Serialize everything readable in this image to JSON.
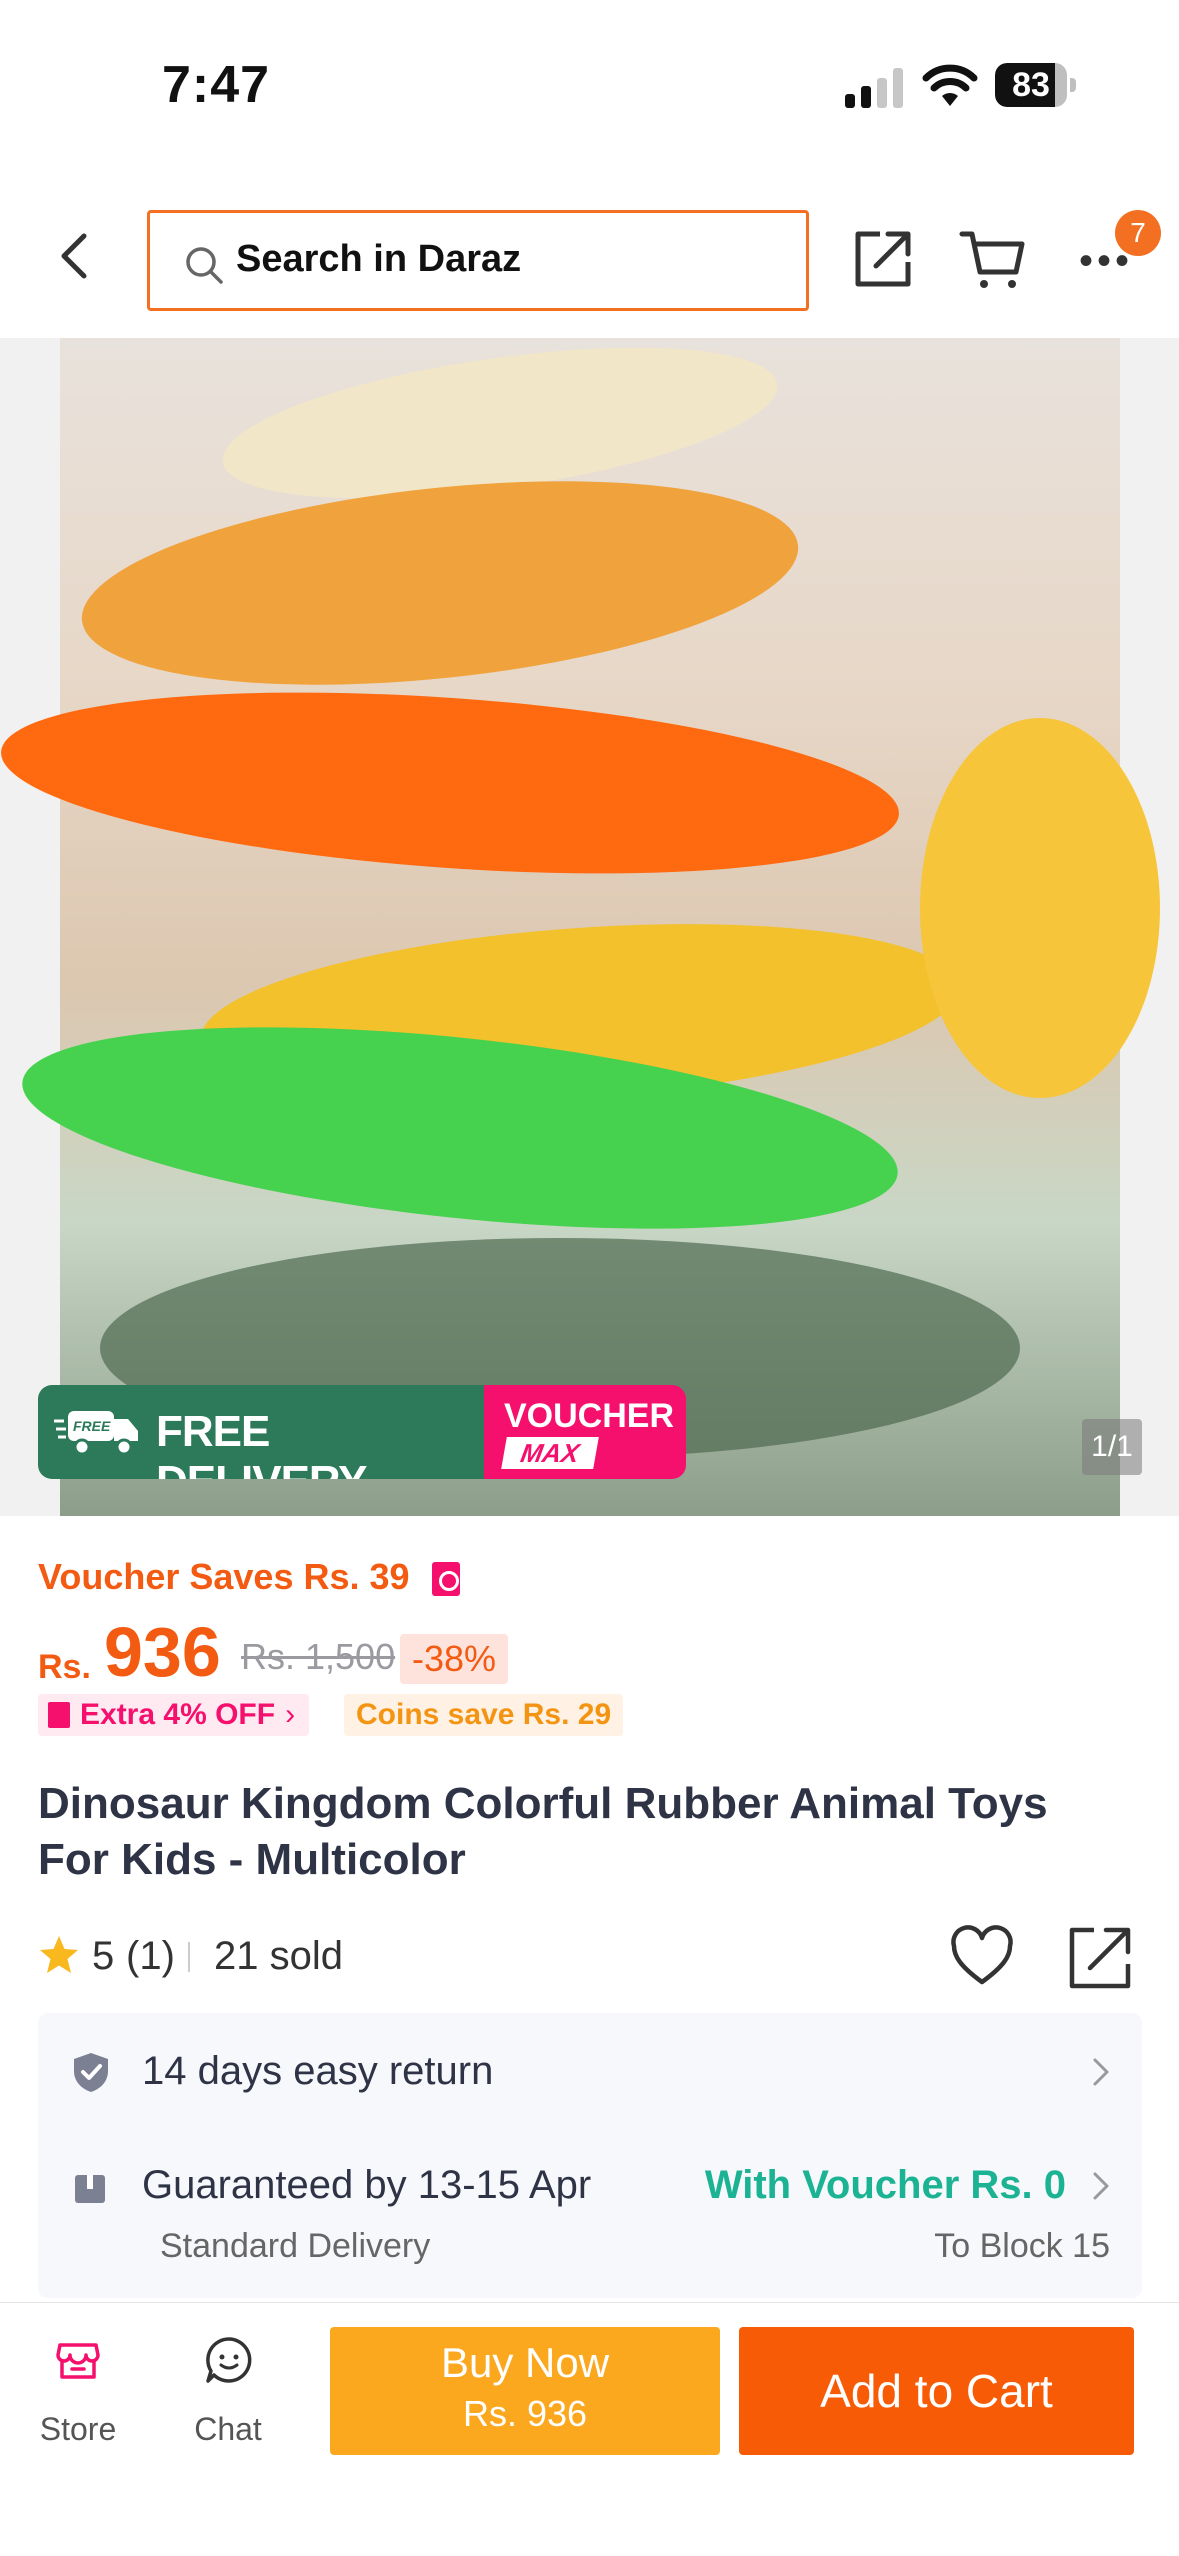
{
  "status_bar": {
    "time": "7:47",
    "battery": "83",
    "battery_level_pct": 83
  },
  "header": {
    "search_placeholder": "Search in Daraz",
    "more_badge": "7",
    "icons": [
      "back-arrow-icon",
      "search-icon",
      "share-icon",
      "cart-icon",
      "more-icon"
    ]
  },
  "product_image": {
    "promo_free_delivery": "FREE DELIVERY",
    "promo_free_tag": "FREE",
    "promo_voucher_line1": "VOUCHER",
    "promo_voucher_line2": "MAX",
    "counter": "1/1"
  },
  "pricing": {
    "voucher_saves": "Voucher Saves Rs. 39",
    "currency": "Rs.",
    "price": "936",
    "old_price": "Rs. 1,500",
    "discount": "-38%",
    "extra_off": "Extra 4% OFF",
    "coins_save": "Coins save Rs. 29"
  },
  "product": {
    "title": "Dinosaur Kingdom Colorful Rubber Animal Toys For Kids - Multicolor",
    "rating": "5",
    "rating_count": "(1)",
    "sold": "21 sold"
  },
  "info": {
    "return_text": "14 days easy return",
    "guaranteed": "Guaranteed by 13-15 Apr",
    "voucher_delivery": "With Voucher Rs. 0",
    "standard_delivery": "Standard Delivery",
    "to_block": "To Block 15"
  },
  "bottom_bar": {
    "store_label": "Store",
    "chat_label": "Chat",
    "buy_now_label": "Buy Now",
    "buy_now_price": "Rs. 936",
    "add_to_cart_label": "Add to Cart"
  },
  "colors": {
    "accent": "#f85b06",
    "price_orange": "#f35b12",
    "buy_now": "#fca81f",
    "voucher_green": "#1bb394",
    "promo_green": "#2d7a5b",
    "voucher_pink": "#f5106e"
  }
}
